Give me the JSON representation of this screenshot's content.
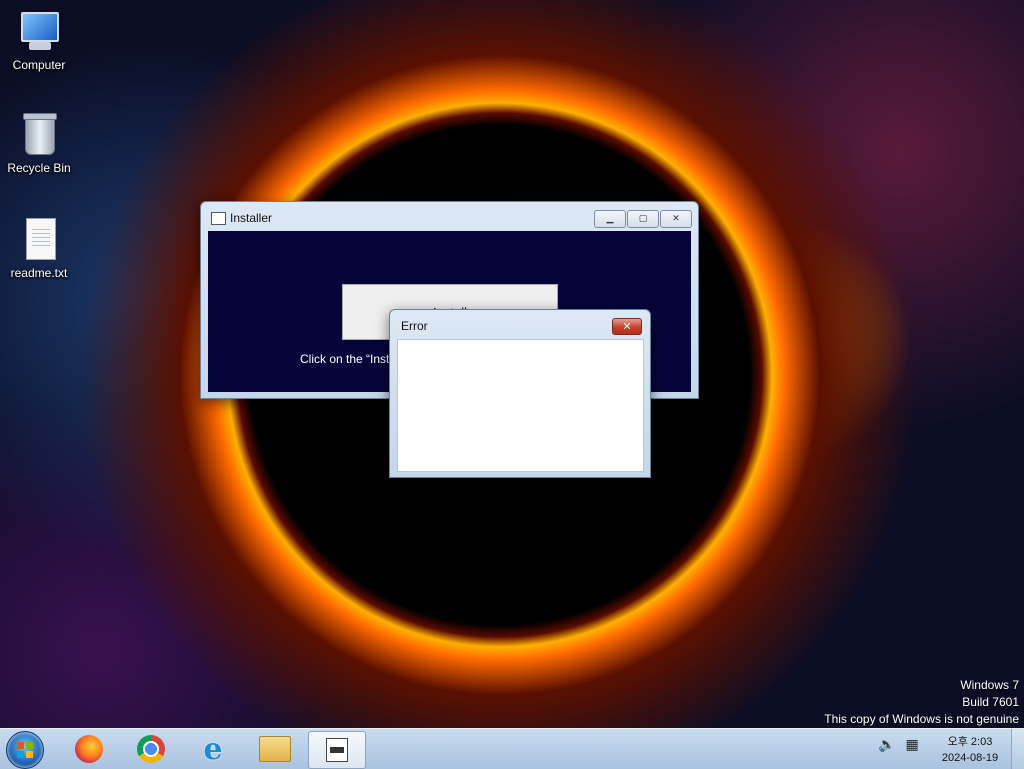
{
  "desktop": {
    "icons": [
      {
        "label": "Computer",
        "icon": "computer-icon"
      },
      {
        "label": "Recycle Bin",
        "icon": "recycle-bin-icon"
      },
      {
        "label": "readme.txt",
        "icon": "text-file-icon"
      }
    ]
  },
  "installer_window": {
    "title": "Installer",
    "install_button_label": "Install",
    "instructions": "Click on the “Inst"
  },
  "error_dialog": {
    "title": "Error",
    "close_glyph": "✕"
  },
  "watermark": {
    "line1": "Windows 7",
    "line2": "Build 7601",
    "line3": "This copy of Windows is not genuine"
  },
  "taskbar": {
    "apps": [
      {
        "name": "firefox-icon"
      },
      {
        "name": "chrome-icon"
      },
      {
        "name": "internet-explorer-icon"
      },
      {
        "name": "file-explorer-icon"
      },
      {
        "name": "installer-app-icon",
        "active": true
      }
    ],
    "clock_time": "오후 2:03",
    "clock_date": "2024-08-19"
  },
  "colors": {
    "installer_bg": "#05053a",
    "error_close": "#c4402c"
  }
}
